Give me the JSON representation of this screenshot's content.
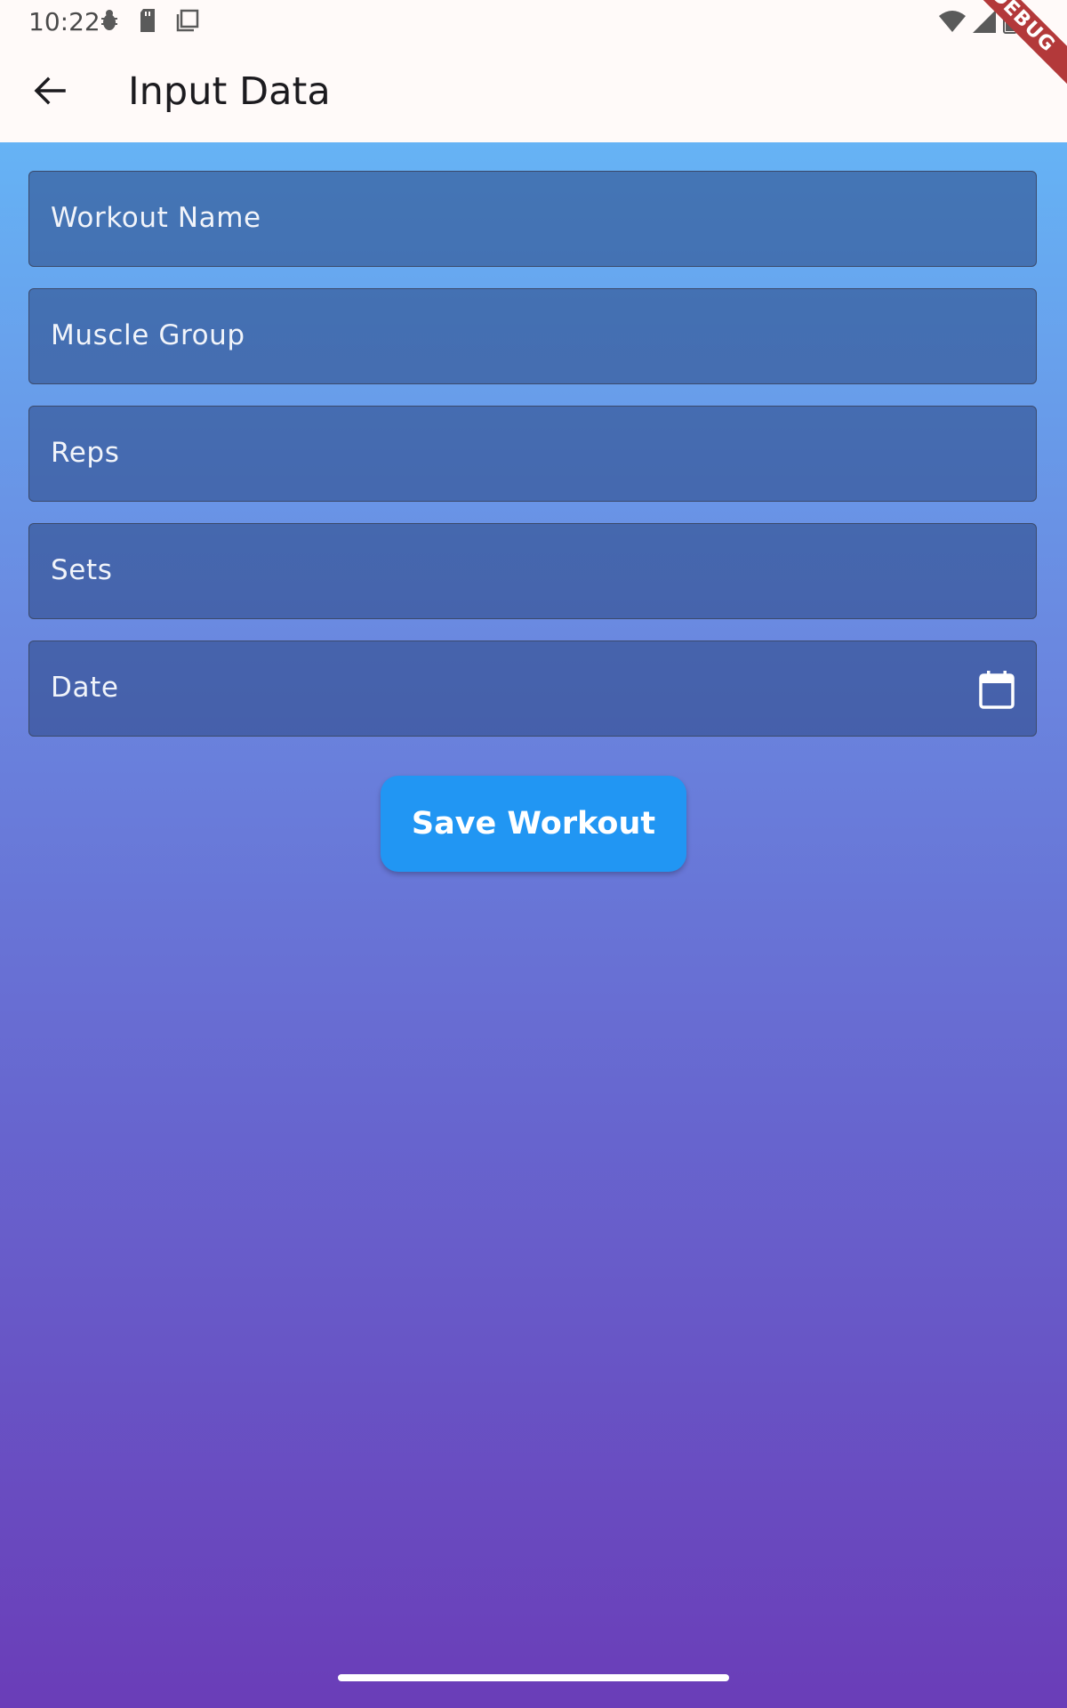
{
  "status_bar": {
    "time": "10:22",
    "icons_left": [
      "bug-icon",
      "sd-card-icon",
      "screen-icon"
    ],
    "icons_right": [
      "wifi-icon",
      "signal-icon",
      "battery-icon"
    ]
  },
  "app_bar": {
    "back_icon": "arrow-back-icon",
    "title": "Input Data",
    "debug_label": "DEBUG"
  },
  "form": {
    "fields": [
      {
        "label": "Workout Name"
      },
      {
        "label": "Muscle Group"
      },
      {
        "label": "Reps"
      },
      {
        "label": "Sets"
      },
      {
        "label": "Date",
        "icon": "calendar-icon"
      }
    ],
    "save_label": "Save Workout"
  },
  "colors": {
    "appbar_bg": "#fffaf9",
    "gradient_top": "#66b3f5",
    "gradient_bottom": "#6a3db8",
    "button": "#2196f3",
    "debug_banner": "#b3393a"
  }
}
